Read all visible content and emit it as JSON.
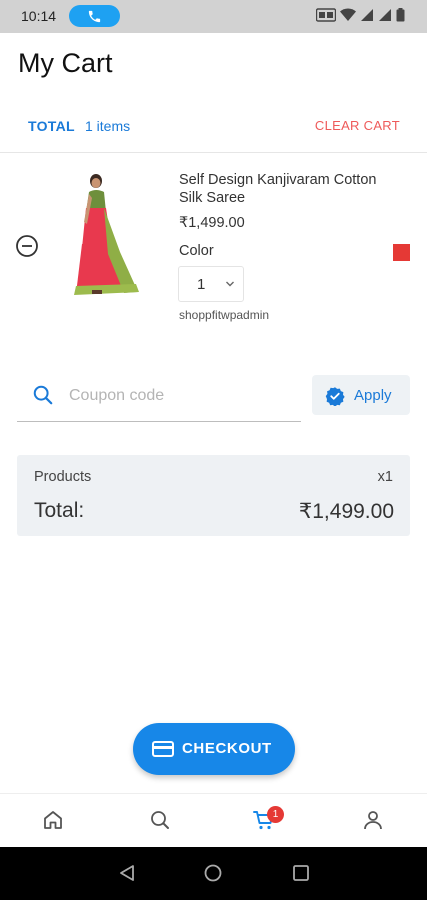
{
  "status_bar": {
    "time": "10:14"
  },
  "header": {
    "title": "My Cart"
  },
  "summary": {
    "total_label": "TOTAL",
    "items_count": "1 items",
    "clear_cart_label": "CLEAR CART"
  },
  "cart_item": {
    "name": "Self Design Kanjivaram Cotton Silk Saree",
    "price": "₹1,499.00",
    "color_label": "Color",
    "color_value": "#e53935",
    "quantity": "1",
    "vendor": "shoppfitwpadmin"
  },
  "coupon": {
    "placeholder": "Coupon code",
    "value": "",
    "apply_label": "Apply"
  },
  "totals": {
    "products_label": "Products",
    "products_count": "x1",
    "total_label": "Total:",
    "total_amount": "₹1,499.00"
  },
  "checkout": {
    "label": "CHECKOUT"
  },
  "bottom_nav": {
    "items": [
      {
        "icon": "home-icon"
      },
      {
        "icon": "search-icon"
      },
      {
        "icon": "cart-icon",
        "badge": "1"
      },
      {
        "icon": "profile-icon"
      }
    ]
  },
  "colors": {
    "accent": "#1787e8",
    "link_blue": "#1a7ad8",
    "danger": "#ee5a5a",
    "badge": "#e53935"
  }
}
